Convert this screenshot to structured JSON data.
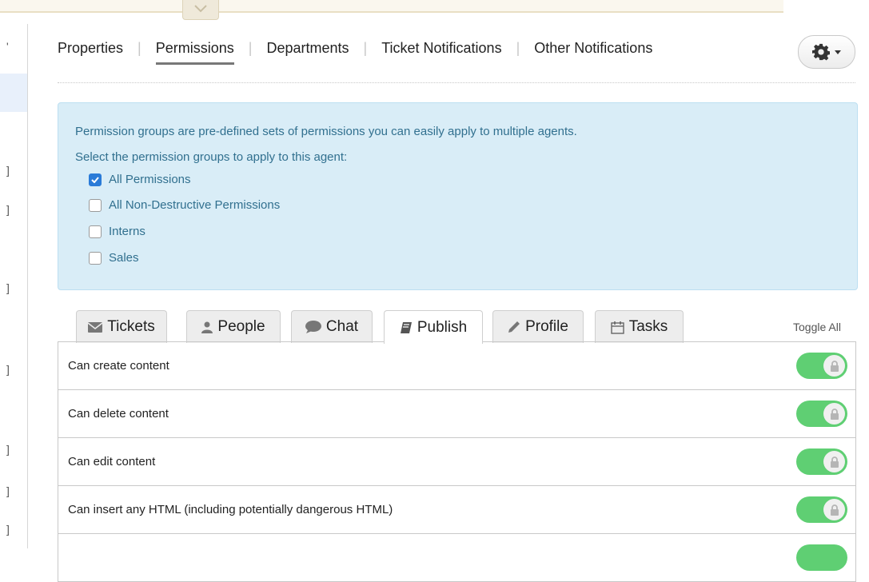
{
  "nav": {
    "tabs": [
      "Properties",
      "Permissions",
      "Departments",
      "Ticket Notifications",
      "Other Notifications"
    ],
    "active": "Permissions"
  },
  "info": {
    "line1": "Permission groups are pre-defined sets of permissions you can easily apply to multiple agents.",
    "line2": "Select the permission groups to apply to this agent:",
    "groups": [
      {
        "label": "All Permissions",
        "checked": true
      },
      {
        "label": "All Non-Destructive Permissions",
        "checked": false
      },
      {
        "label": "Interns",
        "checked": false
      },
      {
        "label": "Sales",
        "checked": false
      }
    ]
  },
  "perm_tabs": [
    {
      "label": "Tickets",
      "icon": "envelope-icon"
    },
    {
      "label": "People",
      "icon": "person-icon"
    },
    {
      "label": "Chat",
      "icon": "chat-bubble-icon"
    },
    {
      "label": "Publish",
      "icon": "book-icon"
    },
    {
      "label": "Profile",
      "icon": "pencil-icon"
    },
    {
      "label": "Tasks",
      "icon": "calendar-icon"
    }
  ],
  "active_perm_tab": "Publish",
  "toggle_all": "Toggle All",
  "permissions": [
    {
      "label": "Can create content",
      "enabled": true,
      "locked": true
    },
    {
      "label": "Can delete content",
      "enabled": true,
      "locked": true
    },
    {
      "label": "Can edit content",
      "enabled": true,
      "locked": true
    },
    {
      "label": "Can insert any HTML (including potentially dangerous HTML)",
      "enabled": true,
      "locked": true
    }
  ],
  "colors": {
    "info_bg": "#d9edf7",
    "info_text": "#31708f",
    "toggle_on": "#5fcf73",
    "checkbox": "#2a7bd8"
  },
  "left_pane": {
    "marks": [
      "'",
      "]",
      "]",
      "]",
      "]",
      "]",
      "]",
      "]"
    ]
  }
}
